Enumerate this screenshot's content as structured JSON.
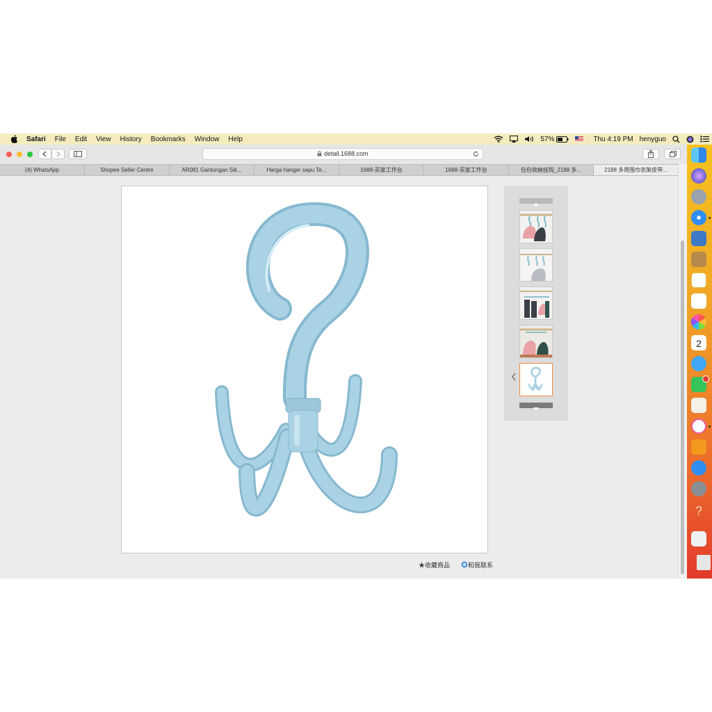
{
  "menubar": {
    "app_name": "Safari",
    "menus": [
      "File",
      "Edit",
      "View",
      "History",
      "Bookmarks",
      "Window",
      "Help"
    ],
    "battery": "57%",
    "clock": "Thu 4:19 PM",
    "user": "henyguo"
  },
  "browser": {
    "url": "detail.1688.com",
    "tabs": [
      "(4) WhatsApp",
      "Shopee Seller Centre",
      "AR081 Gantungan Sik...",
      "Harga hanger sapu Te...",
      "1688-买家工作台",
      "1688-买家工作台",
      "包包收納挂钩_2188 多...",
      "2188 多用围巾衣架皮带..."
    ],
    "active_tab_index": 7,
    "new_tab_symbol": "+"
  },
  "product": {
    "favorite_label": "★收藏商品",
    "contact_label": "和我联系"
  },
  "thumbnails": {
    "count": 5,
    "selected_index": 4
  },
  "calendar_day": "2",
  "colors": {
    "hook": "#a9d2e4",
    "hook_shadow": "#86b8cf",
    "menubar": "#f4ecbe",
    "selected_thumb_border": "#f08a3c"
  }
}
